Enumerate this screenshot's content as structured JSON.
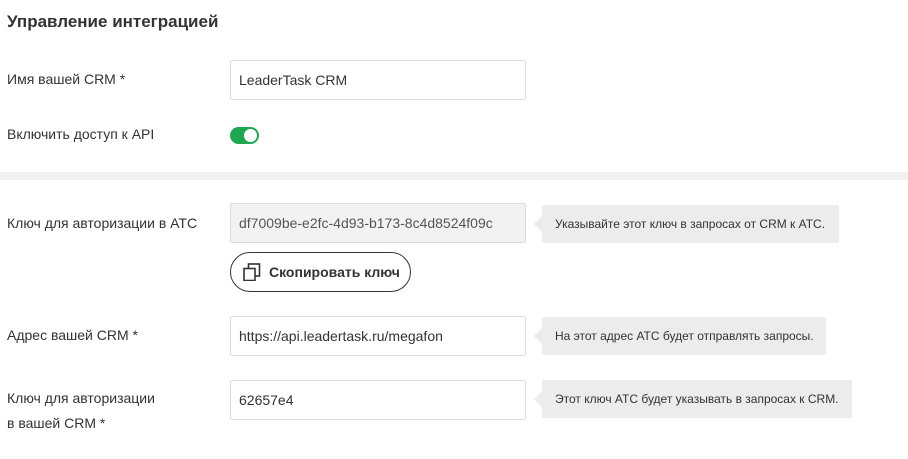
{
  "page": {
    "title": "Управление интеграцией"
  },
  "fields": {
    "crm_name": {
      "label": "Имя вашей CRM *",
      "value": "LeaderTask CRM"
    },
    "api_access": {
      "label": "Включить доступ к API",
      "enabled": true
    },
    "ats_key": {
      "label": "Ключ для авторизации в АТС",
      "value": "df7009be-e2fc-4d93-b173-8c4d8524f09c",
      "hint": "Указывайте этот ключ в запросах от CRM к АТС.",
      "copy_button_label": "Скопировать ключ"
    },
    "crm_address": {
      "label": "Адрес вашей CRM *",
      "value": "https://api.leadertask.ru/megafon",
      "hint": "На этот адрес АТС будет отправлять запросы."
    },
    "crm_key": {
      "label_line1": "Ключ для авторизации",
      "label_line2": "в вашей CRM *",
      "value": "62657e4",
      "hint": "Этот ключ АТС будет указывать в запросах к CRM."
    }
  },
  "icons": {
    "copy": "copy-icon"
  },
  "colors": {
    "toggle_on": "#1ea750",
    "hint_bg": "#ececec",
    "separator": "#f2f2f2"
  }
}
